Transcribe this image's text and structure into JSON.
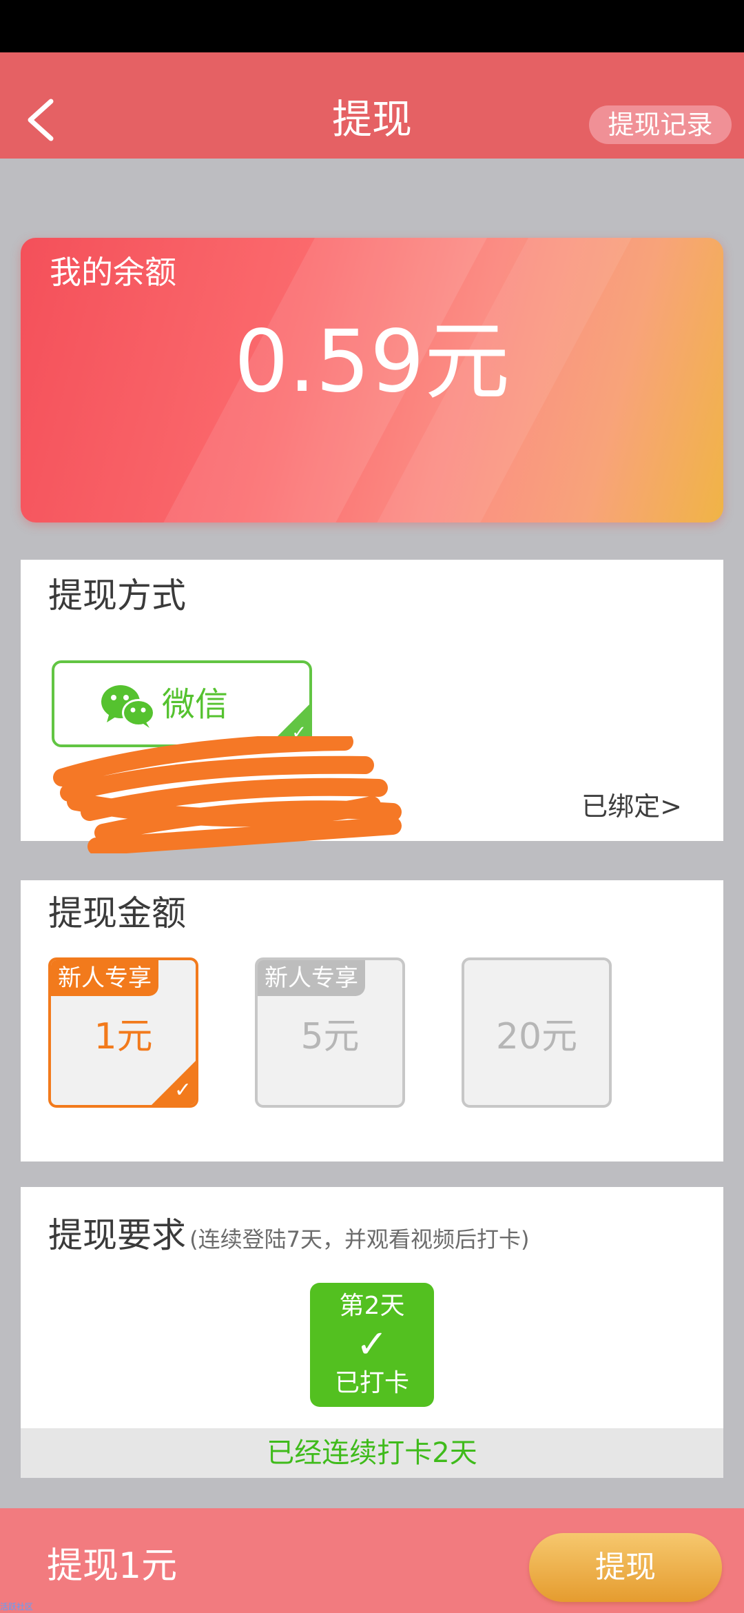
{
  "header": {
    "title": "提现",
    "records_label": "提现记录"
  },
  "balance": {
    "label": "我的余额",
    "amount": "0.59元"
  },
  "method": {
    "title": "提现方式",
    "option_label": "微信",
    "bound_label": "已绑定>"
  },
  "amounts": {
    "title": "提现金额",
    "options": [
      {
        "tag": "新人专享",
        "value": "1元",
        "selected": true
      },
      {
        "tag": "新人专享",
        "value": "5元",
        "selected": false
      },
      {
        "tag": "",
        "value": "20元",
        "selected": false
      }
    ]
  },
  "requirement": {
    "title": "提现要求",
    "note": "(连续登陆7天，并观看视频后打卡)",
    "day_label": "第2天",
    "checkin_label": "已打卡",
    "streak_text": "已经连续打卡2天"
  },
  "footer": {
    "summary": "提现1元",
    "withdraw_label": "提现"
  },
  "watermark": "活跃社区",
  "colors": {
    "nav": "#e56164",
    "wechat_green": "#62c543",
    "selected_orange": "#f27a1c",
    "checkin_green": "#53c020"
  }
}
